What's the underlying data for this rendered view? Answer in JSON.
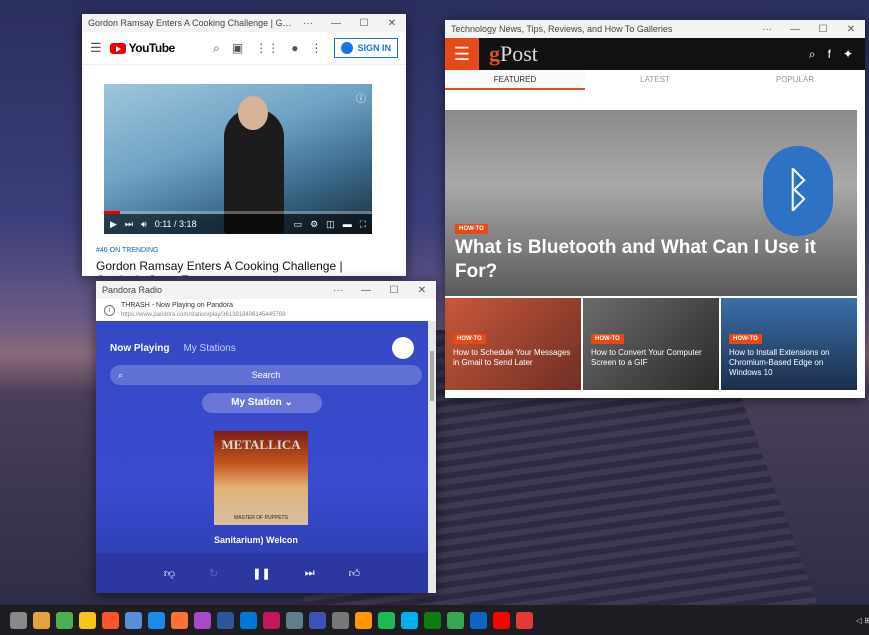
{
  "youtube_window": {
    "title": "Gordon Ramsay Enters A Cooking Challenge | Gordon's",
    "sign_in": "SIGN IN",
    "logo": "YouTube",
    "video_time": "0:11 / 3:18",
    "trending": "#46 ON TRENDING",
    "video_title": "Gordon Ramsay Enters A Cooking Challenge | Gordon's Great Escape"
  },
  "gpost_window": {
    "title": "Technology News, Tips, Reviews, and How To Galleries",
    "logo_g": "g",
    "logo_post": "Post",
    "tabs": [
      "FEATURED",
      "LATEST",
      "POPULAR"
    ],
    "hero_tag": "HOW-TO",
    "hero_title": "What is Bluetooth and What Can I Use it For?",
    "cards": [
      {
        "tag": "HOW-TO",
        "title": "How to Schedule Your Messages in Gmail to Send Later"
      },
      {
        "tag": "HOW-TO",
        "title": "How to Convert Your Computer Screen to a GIF"
      },
      {
        "tag": "HOW-TO",
        "title": "How to Install Extensions on Chromium-Based Edge on Windows 10"
      }
    ]
  },
  "pandora_window": {
    "title": "Pandora Radio",
    "page_title": "THRASH - Now Playing on Pandora",
    "url": "https://www.pandora.com/station/play/3613918406145445769",
    "tab_now_playing": "Now Playing",
    "tab_my_stations": "My Stations",
    "search_placeholder": "Search",
    "station": "My Station",
    "album_band": "METALLICA",
    "album_name": "MASTER OF PUPPETS",
    "now_playing_text": "Sanitarium)   Welcon"
  },
  "window_controls": {
    "minimize": "—",
    "maximize": "☐",
    "close": "✕",
    "more": "···"
  },
  "taskbar": {
    "apps": [
      "settings",
      "store",
      "chrome",
      "weather",
      "brave",
      "app-grid",
      "edge",
      "firefox",
      "media",
      "word",
      "app",
      "app2",
      "mail",
      "calendar",
      "calculator",
      "app3",
      "spotify",
      "skype",
      "xbox",
      "maps",
      "app4",
      "youtube",
      "app5"
    ]
  }
}
